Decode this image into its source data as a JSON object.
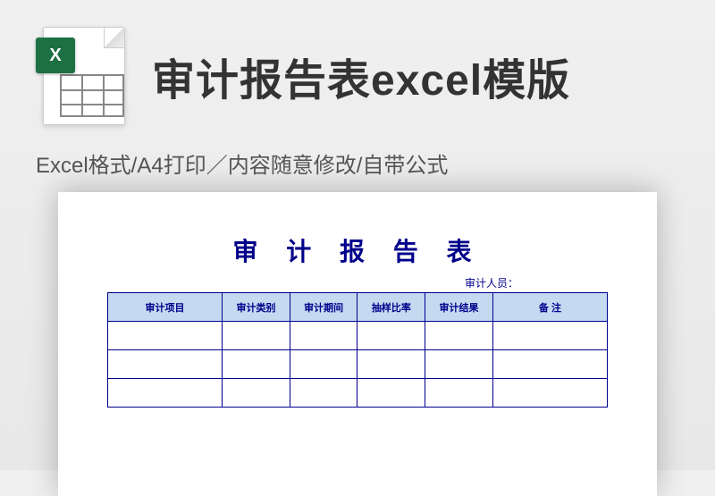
{
  "header": {
    "title": "审计报告表excel模版",
    "icon_badge": "X",
    "subtitle": "Excel格式/A4打印／内容随意修改/自带公式"
  },
  "document": {
    "title": "审 计 报 告 表",
    "auditor_label": "审计人员：",
    "columns": [
      "审计项目",
      "审计类别",
      "审计期间",
      "抽样比率",
      "审计结果",
      "备  注"
    ]
  }
}
